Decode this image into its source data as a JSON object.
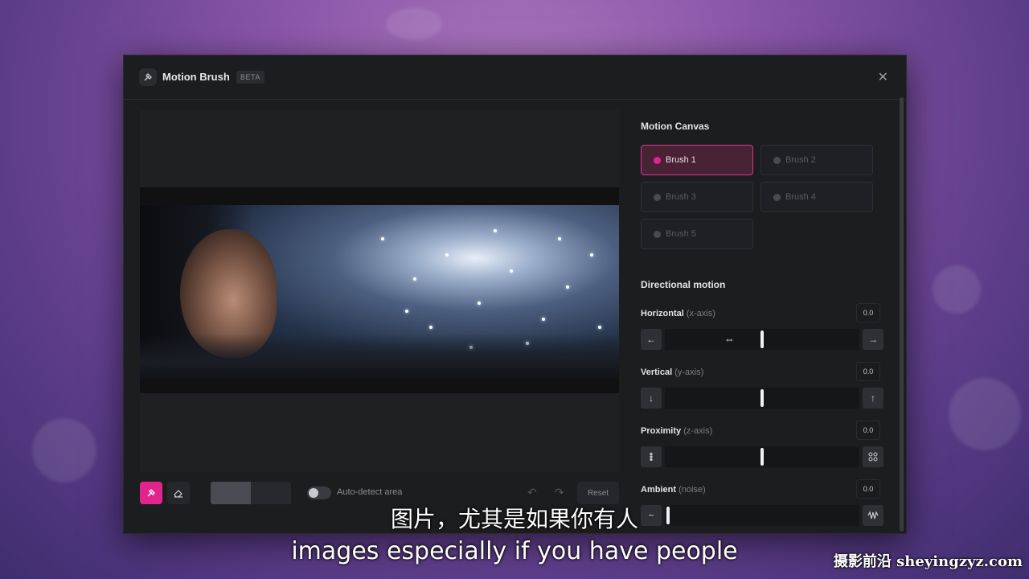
{
  "modal": {
    "title": "Motion Brush",
    "badge": "BETA",
    "close_icon": "close-icon"
  },
  "canvas": {
    "toolbar": {
      "brush_tool_icon": "brush-icon",
      "eraser_tool_icon": "eraser-icon",
      "brush_size_level": 0.5,
      "auto_detect_label": "Auto-detect area",
      "auto_detect_on": false,
      "undo_icon": "undo-icon",
      "redo_icon": "redo-icon",
      "reset_label": "Reset"
    },
    "accent_color": "#e2258d"
  },
  "motion_canvas": {
    "title": "Motion Canvas",
    "brushes": [
      {
        "label": "Brush 1",
        "active": true
      },
      {
        "label": "Brush 2",
        "active": false
      },
      {
        "label": "Brush 3",
        "active": false
      },
      {
        "label": "Brush 4",
        "active": false
      },
      {
        "label": "Brush 5",
        "active": false
      }
    ]
  },
  "directional_motion": {
    "title": "Directional motion",
    "controls": [
      {
        "label": "Horizontal",
        "axis": "(x-axis)",
        "value": "0.0",
        "left_icon": "arrow-left-icon",
        "right_icon": "arrow-right-icon"
      },
      {
        "label": "Vertical",
        "axis": "(y-axis)",
        "value": "0.0",
        "left_icon": "arrow-down-icon",
        "right_icon": "arrow-up-icon"
      },
      {
        "label": "Proximity",
        "axis": "(z-axis)",
        "value": "0.0",
        "left_icon": "shrink-icon",
        "right_icon": "expand-icon"
      },
      {
        "label": "Ambient",
        "axis": "(noise)",
        "value": "0.0",
        "left_icon": "wave-low-icon",
        "right_icon": "wave-high-icon"
      }
    ]
  },
  "subtitles": {
    "chinese": "图片，尤其是如果你有人",
    "english": "images especially if you have people"
  },
  "watermark": "摄影前沿 sheyingzyz.com"
}
